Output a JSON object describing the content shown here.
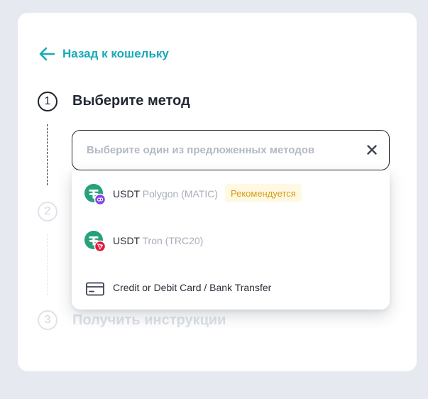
{
  "back": {
    "label": "Назад к кошельку"
  },
  "steps": [
    {
      "number": "1",
      "title": "Выберите метод"
    },
    {
      "number": "2"
    },
    {
      "number": "3",
      "title": "Получить инструкции"
    }
  ],
  "select": {
    "placeholder": "Выберите один из предложенных методов"
  },
  "options": [
    {
      "coin": "USDT",
      "network": "Polygon (MATIC)",
      "badge": "Рекомендуется",
      "icon": "tether-polygon-icon"
    },
    {
      "coin": "USDT",
      "network": "Tron (TRC20)",
      "icon": "tether-tron-icon"
    },
    {
      "label": "Credit or Debit Card / Bank Transfer",
      "icon": "credit-card-icon"
    }
  ],
  "colors": {
    "accent": "#1aa9b8",
    "tether": "#26a17b",
    "polygon": "#8247e5",
    "tron": "#e5173b",
    "badge_text": "#d49d12",
    "badge_bg": "#fff8e3"
  }
}
